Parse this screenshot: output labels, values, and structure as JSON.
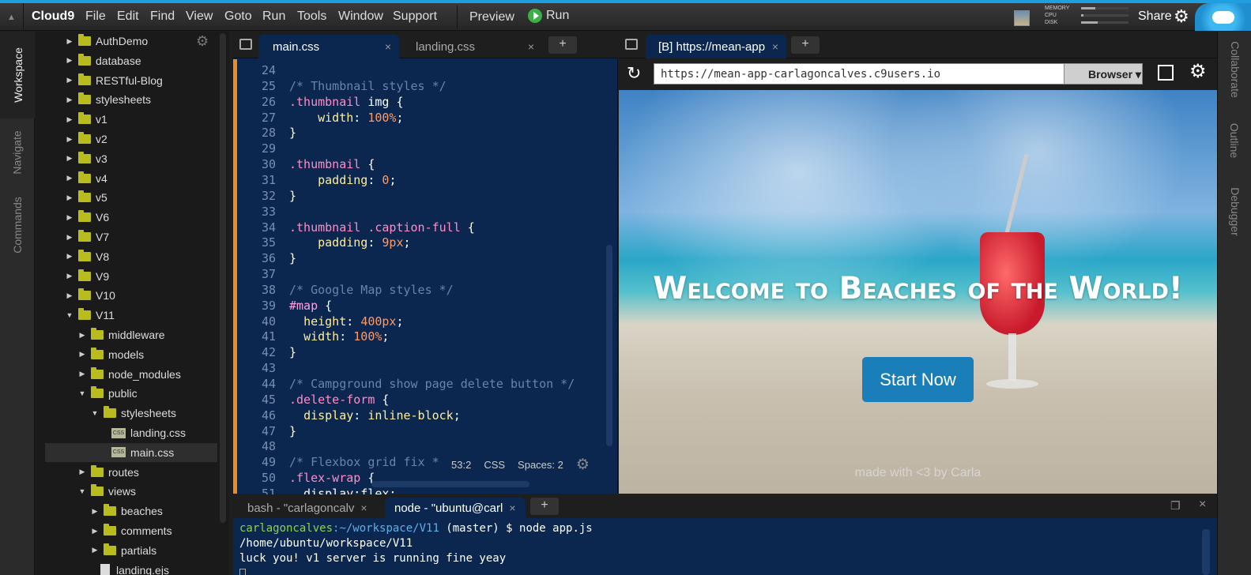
{
  "app": {
    "brand": "Cloud9"
  },
  "menu": [
    "File",
    "Edit",
    "Find",
    "View",
    "Goto",
    "Run",
    "Tools",
    "Window",
    "Support"
  ],
  "toolbar": {
    "preview": "Preview",
    "run": "Run",
    "share": "Share"
  },
  "stats": {
    "memory": "MEMORY",
    "cpu": "CPU",
    "disk": "DISK",
    "memory_level": 0.3,
    "cpu_level": 0.05,
    "disk_level": 0.35
  },
  "left_tabs": [
    "Workspace",
    "Navigate",
    "Commands"
  ],
  "right_tabs": [
    "Collaborate",
    "Outline",
    "Debugger"
  ],
  "tree": [
    {
      "label": "AuthDemo",
      "depth": 0,
      "type": "folder",
      "open": false
    },
    {
      "label": "database",
      "depth": 0,
      "type": "folder",
      "open": false
    },
    {
      "label": "RESTful-Blog",
      "depth": 0,
      "type": "folder",
      "open": false
    },
    {
      "label": "stylesheets",
      "depth": 0,
      "type": "folder",
      "open": false
    },
    {
      "label": "v1",
      "depth": 0,
      "type": "folder",
      "open": false
    },
    {
      "label": "v2",
      "depth": 0,
      "type": "folder",
      "open": false
    },
    {
      "label": "v3",
      "depth": 0,
      "type": "folder",
      "open": false
    },
    {
      "label": "v4",
      "depth": 0,
      "type": "folder",
      "open": false
    },
    {
      "label": "v5",
      "depth": 0,
      "type": "folder",
      "open": false
    },
    {
      "label": "V6",
      "depth": 0,
      "type": "folder",
      "open": false
    },
    {
      "label": "V7",
      "depth": 0,
      "type": "folder",
      "open": false
    },
    {
      "label": "V8",
      "depth": 0,
      "type": "folder",
      "open": false
    },
    {
      "label": "V9",
      "depth": 0,
      "type": "folder",
      "open": false
    },
    {
      "label": "V10",
      "depth": 0,
      "type": "folder",
      "open": false
    },
    {
      "label": "V11",
      "depth": 0,
      "type": "folder",
      "open": true
    },
    {
      "label": "middleware",
      "depth": 1,
      "type": "folder",
      "open": false
    },
    {
      "label": "models",
      "depth": 1,
      "type": "folder",
      "open": false
    },
    {
      "label": "node_modules",
      "depth": 1,
      "type": "folder",
      "open": false
    },
    {
      "label": "public",
      "depth": 1,
      "type": "folder",
      "open": true
    },
    {
      "label": "stylesheets",
      "depth": 2,
      "type": "folder",
      "open": true
    },
    {
      "label": "landing.css",
      "depth": 3,
      "type": "css"
    },
    {
      "label": "main.css",
      "depth": 3,
      "type": "css",
      "selected": true
    },
    {
      "label": "routes",
      "depth": 1,
      "type": "folder",
      "open": false
    },
    {
      "label": "views",
      "depth": 1,
      "type": "folder",
      "open": true
    },
    {
      "label": "beaches",
      "depth": 2,
      "type": "folder",
      "open": false
    },
    {
      "label": "comments",
      "depth": 2,
      "type": "folder",
      "open": false
    },
    {
      "label": "partials",
      "depth": 2,
      "type": "folder",
      "open": false
    },
    {
      "label": "landing.ejs",
      "depth": 2,
      "type": "file"
    }
  ],
  "editor": {
    "tabs": [
      {
        "label": "main.css",
        "active": true
      },
      {
        "label": "landing.css",
        "active": false
      }
    ],
    "add_tab": "+",
    "close": "×",
    "lines": [
      {
        "n": "24",
        "parts": []
      },
      {
        "n": "25",
        "parts": [
          [
            "c-comment",
            "/* Thumbnail styles */"
          ]
        ]
      },
      {
        "n": "26",
        "parts": [
          [
            "c-sel",
            ".thumbnail"
          ],
          [
            "c-brace",
            " img {"
          ]
        ]
      },
      {
        "n": "27",
        "parts": [
          [
            "c-brace",
            "    "
          ],
          [
            "c-prop",
            "width"
          ],
          [
            "c-brace",
            ": "
          ],
          [
            "c-num",
            "100%"
          ],
          [
            "c-brace",
            ";"
          ]
        ]
      },
      {
        "n": "28",
        "parts": [
          [
            "c-brace",
            "}"
          ]
        ]
      },
      {
        "n": "29",
        "parts": []
      },
      {
        "n": "30",
        "parts": [
          [
            "c-sel",
            ".thumbnail"
          ],
          [
            "c-brace",
            " {"
          ]
        ]
      },
      {
        "n": "31",
        "parts": [
          [
            "c-brace",
            "    "
          ],
          [
            "c-prop",
            "padding"
          ],
          [
            "c-brace",
            ": "
          ],
          [
            "c-num",
            "0"
          ],
          [
            "c-brace",
            ";"
          ]
        ]
      },
      {
        "n": "32",
        "parts": [
          [
            "c-brace",
            "}"
          ]
        ]
      },
      {
        "n": "33",
        "parts": []
      },
      {
        "n": "34",
        "parts": [
          [
            "c-sel",
            ".thumbnail .caption-full"
          ],
          [
            "c-brace",
            " {"
          ]
        ]
      },
      {
        "n": "35",
        "parts": [
          [
            "c-brace",
            "    "
          ],
          [
            "c-prop",
            "padding"
          ],
          [
            "c-brace",
            ": "
          ],
          [
            "c-num",
            "9px"
          ],
          [
            "c-brace",
            ";"
          ]
        ]
      },
      {
        "n": "36",
        "parts": [
          [
            "c-brace",
            "}"
          ]
        ]
      },
      {
        "n": "37",
        "parts": []
      },
      {
        "n": "38",
        "parts": [
          [
            "c-comment",
            "/* Google Map styles */"
          ]
        ]
      },
      {
        "n": "39",
        "parts": [
          [
            "c-id",
            "#map"
          ],
          [
            "c-brace",
            " {"
          ]
        ]
      },
      {
        "n": "40",
        "parts": [
          [
            "c-brace",
            "  "
          ],
          [
            "c-prop",
            "height"
          ],
          [
            "c-brace",
            ": "
          ],
          [
            "c-num",
            "400px"
          ],
          [
            "c-brace",
            ";"
          ]
        ]
      },
      {
        "n": "41",
        "parts": [
          [
            "c-brace",
            "  "
          ],
          [
            "c-prop",
            "width"
          ],
          [
            "c-brace",
            ": "
          ],
          [
            "c-num",
            "100%"
          ],
          [
            "c-brace",
            ";"
          ]
        ]
      },
      {
        "n": "42",
        "parts": [
          [
            "c-brace",
            "}"
          ]
        ]
      },
      {
        "n": "43",
        "parts": []
      },
      {
        "n": "44",
        "parts": [
          [
            "c-comment",
            "/* Campground show page delete button */"
          ]
        ]
      },
      {
        "n": "45",
        "parts": [
          [
            "c-sel",
            ".delete-form"
          ],
          [
            "c-brace",
            " {"
          ]
        ]
      },
      {
        "n": "46",
        "parts": [
          [
            "c-brace",
            "  "
          ],
          [
            "c-prop",
            "display"
          ],
          [
            "c-brace",
            ": "
          ],
          [
            "c-val",
            "inline-block"
          ],
          [
            "c-brace",
            ";"
          ]
        ]
      },
      {
        "n": "47",
        "parts": [
          [
            "c-brace",
            "}"
          ]
        ]
      },
      {
        "n": "48",
        "parts": []
      },
      {
        "n": "49",
        "parts": [
          [
            "c-comment",
            "/* Flexbox grid fix *"
          ]
        ]
      },
      {
        "n": "50",
        "parts": [
          [
            "c-sel",
            ".flex-wrap"
          ],
          [
            "c-brace",
            " {"
          ]
        ]
      },
      {
        "n": "51",
        "parts": [
          [
            "c-brace",
            "  display:flex;"
          ]
        ]
      }
    ],
    "status": {
      "position": "53:2",
      "mode": "CSS",
      "spaces": "Spaces: 2"
    }
  },
  "preview": {
    "tab": "[B] https://mean-app",
    "close": "×",
    "add_tab": "+",
    "url": "https://mean-app-carlagoncalves.c9users.io",
    "browser": "Browser",
    "welcome": "Welcome to Beaches of the World!",
    "start": "Start Now",
    "madewith": "made with <3 by Carla"
  },
  "terminal": {
    "tabs": [
      {
        "label": "bash - \"carlagoncalv",
        "active": false
      },
      {
        "label": "node - \"ubuntu@carl",
        "active": true
      }
    ],
    "add_tab": "+",
    "close": "×",
    "prompt_user": "carlagoncalves",
    "prompt_path": ":~/workspace/V11",
    "prompt_rest": " (master) $ node app.js",
    "line2": "/home/ubuntu/workspace/V11",
    "line3": "luck you! v1 server is running fine yeay"
  }
}
